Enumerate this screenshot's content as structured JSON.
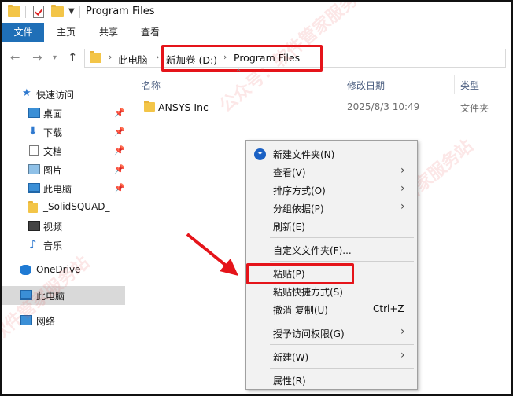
{
  "window": {
    "title": "Program Files"
  },
  "ribbon": {
    "tabs": [
      "文件",
      "主页",
      "共享",
      "查看"
    ]
  },
  "address": {
    "crumbs": [
      "此电脑",
      "新加卷 (D:)",
      "Program Files"
    ]
  },
  "sidebar": {
    "items": [
      {
        "label": "快速访问",
        "icon": "star-icon"
      },
      {
        "label": "桌面",
        "icon": "desktop-icon",
        "pinned": true
      },
      {
        "label": "下载",
        "icon": "download-icon",
        "pinned": true
      },
      {
        "label": "文档",
        "icon": "document-icon",
        "pinned": true
      },
      {
        "label": "图片",
        "icon": "pictures-icon",
        "pinned": true
      },
      {
        "label": "此电脑",
        "icon": "computer-icon",
        "pinned": true
      },
      {
        "label": "_SolidSQUAD_",
        "icon": "folder-icon"
      },
      {
        "label": "视频",
        "icon": "video-icon"
      },
      {
        "label": "音乐",
        "icon": "music-icon"
      },
      {
        "label": "OneDrive",
        "icon": "cloud-icon"
      },
      {
        "label": "此电脑",
        "icon": "computer-icon",
        "selected": true
      },
      {
        "label": "网络",
        "icon": "network-icon"
      }
    ]
  },
  "columns": {
    "name": "名称",
    "modified": "修改日期",
    "type": "类型"
  },
  "files": [
    {
      "name": "ANSYS Inc",
      "modified": "2025/8/3 10:49",
      "type": "文件夹"
    }
  ],
  "context_menu": {
    "items": [
      {
        "label": "新建文件夹(N)",
        "icon": "new-folder-icon"
      },
      {
        "label": "查看(V)",
        "submenu": true
      },
      {
        "label": "排序方式(O)",
        "submenu": true
      },
      {
        "label": "分组依据(P)",
        "submenu": true
      },
      {
        "label": "刷新(E)"
      },
      {
        "label": "自定义文件夹(F)..."
      },
      {
        "label": "粘贴(P)",
        "highlighted": true
      },
      {
        "label": "粘贴快捷方式(S)"
      },
      {
        "label": "撤消 复制(U)",
        "shortcut": "Ctrl+Z"
      },
      {
        "label": "授予访问权限(G)",
        "submenu": true
      },
      {
        "label": "新建(W)",
        "submenu": true
      },
      {
        "label": "属性(R)"
      }
    ]
  },
  "annotation": {
    "color": "#e5141a"
  },
  "watermark": [
    "公众号：软件管家服务站",
    "公众号：软件管家服务站",
    "软件管家服务站"
  ]
}
